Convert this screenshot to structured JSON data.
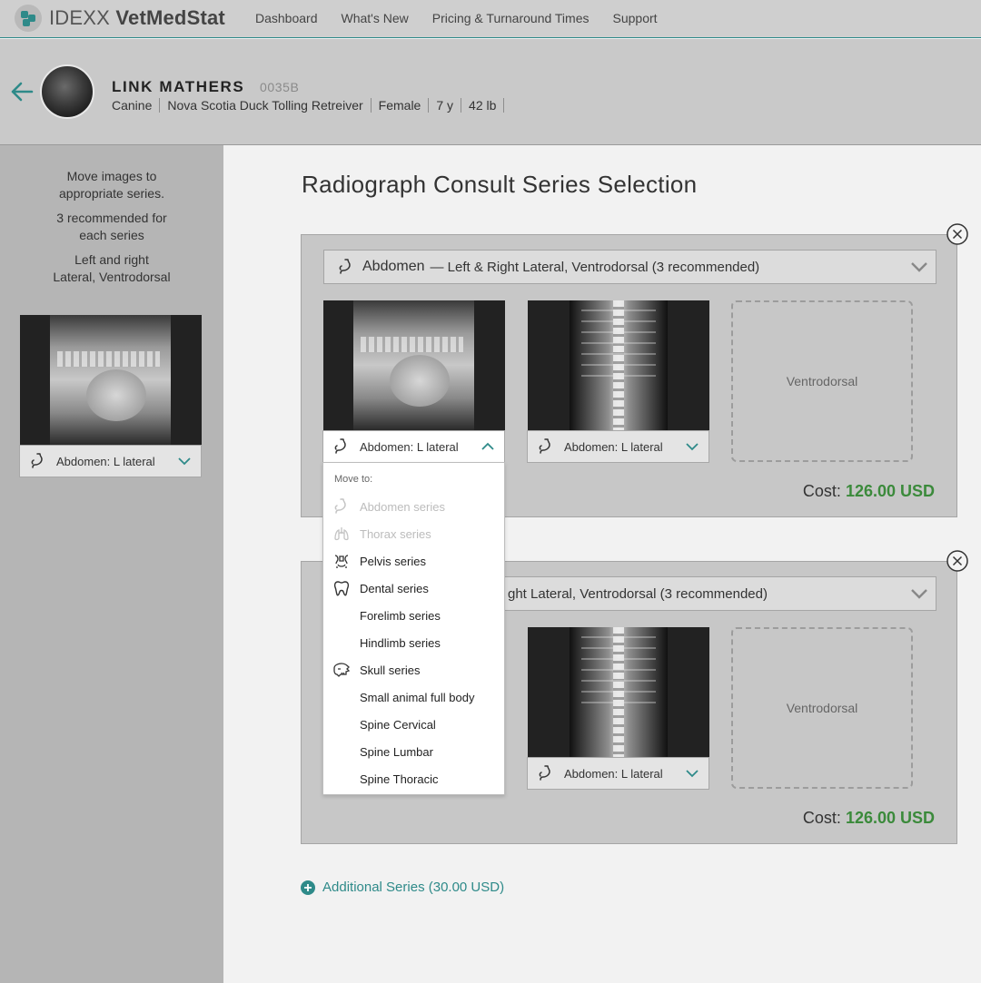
{
  "app": {
    "brand_prefix": "IDEXX",
    "brand_name": "VetMedStat"
  },
  "nav": {
    "items": [
      "Dashboard",
      "What's New",
      "Pricing & Turnaround Times",
      "Support"
    ]
  },
  "patient": {
    "name": "LINK MATHERS",
    "id": "0035B",
    "species": "Canine",
    "breed": "Nova Scotia Duck Tolling Retreiver",
    "sex": "Female",
    "age": "7 y",
    "weight": "42 lb"
  },
  "left_panel": {
    "instructions": [
      [
        "Move images to",
        "appropriate series."
      ],
      [
        "3 recommended for",
        "each series"
      ],
      [
        "Left and right",
        "Lateral, Ventrodorsal"
      ]
    ],
    "unassigned_image_label": "Abdomen: L lateral"
  },
  "page_title": "Radiograph Consult Series Selection",
  "series": [
    {
      "name": "Abdomen",
      "description": "— Left & Right Lateral, Ventrodorsal (3 recommended)",
      "images": [
        {
          "label": "Abdomen: L lateral"
        },
        {
          "label": "Abdomen: L lateral"
        }
      ],
      "empty_slot": "Ventrodorsal",
      "cost_label": "Cost:",
      "cost_value": "126.00 USD"
    },
    {
      "name": "",
      "description": "ght Lateral, Ventrodorsal (3 recommended)",
      "images": [
        {
          "label": "Abdomen: L lateral"
        }
      ],
      "empty_slot": "Ventrodorsal",
      "cost_label": "Cost:",
      "cost_value": "126.00 USD"
    }
  ],
  "move_menu": {
    "header": "Move to:",
    "items": [
      {
        "label": "Abdomen series",
        "icon": "stomach-icon",
        "disabled": true
      },
      {
        "label": "Thorax series",
        "icon": "lungs-icon",
        "disabled": true
      },
      {
        "label": "Pelvis series",
        "icon": "pelvis-icon",
        "disabled": false
      },
      {
        "label": "Dental series",
        "icon": "tooth-icon",
        "disabled": false
      },
      {
        "label": "Forelimb series",
        "icon": "",
        "disabled": false
      },
      {
        "label": "Hindlimb series",
        "icon": "",
        "disabled": false
      },
      {
        "label": "Skull series",
        "icon": "skull-icon",
        "disabled": false
      },
      {
        "label": "Small animal full body",
        "icon": "",
        "disabled": false
      },
      {
        "label": "Spine Cervical",
        "icon": "",
        "disabled": false
      },
      {
        "label": "Spine Lumbar",
        "icon": "",
        "disabled": false
      },
      {
        "label": "Spine Thoracic",
        "icon": "",
        "disabled": false
      }
    ]
  },
  "additional_series": "Additional Series (30.00 USD)",
  "colors": {
    "accent": "#2e8a89",
    "cost_green": "#3b8a3b",
    "disabled_text": "#bcbcbc"
  }
}
